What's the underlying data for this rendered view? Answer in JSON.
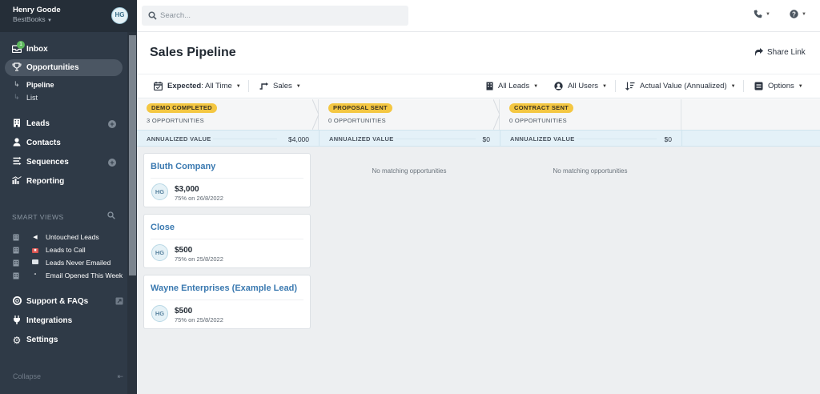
{
  "user": {
    "name": "Henry Goode",
    "org": "BestBooks",
    "initials": "HG"
  },
  "nav": {
    "inbox": "Inbox",
    "inbox_badge": "1",
    "opportunities": "Opportunities",
    "pipeline": "Pipeline",
    "list": "List",
    "leads": "Leads",
    "contacts": "Contacts",
    "sequences": "Sequences",
    "reporting": "Reporting",
    "support": "Support & FAQs",
    "integrations": "Integrations",
    "settings": "Settings",
    "collapse": "Collapse"
  },
  "smart_views": {
    "heading": "SMART VIEWS",
    "items": [
      "Untouched Leads",
      "Leads to Call",
      "Leads Never Emailed",
      "Email Opened This Week"
    ]
  },
  "search": {
    "placeholder": "Search..."
  },
  "header": {
    "title": "Sales Pipeline",
    "share": "Share Link"
  },
  "filters": {
    "expected_key": "Expected",
    "expected_val": ": All Time",
    "pipeline": "Sales",
    "leads": "All Leads",
    "users": "All Users",
    "sort": "Actual Value (Annualized)",
    "options": "Options"
  },
  "value_label": "ANNUALIZED VALUE",
  "stages": [
    {
      "name": "DEMO COMPLETED",
      "count": "3 OPPORTUNITIES",
      "value": "$4,000"
    },
    {
      "name": "PROPOSAL SENT",
      "count": "0 OPPORTUNITIES",
      "value": "$0",
      "empty": "No matching opportunities"
    },
    {
      "name": "CONTRACT SENT",
      "count": "0 OPPORTUNITIES",
      "value": "$0",
      "empty": "No matching opportunities"
    }
  ],
  "cards": [
    {
      "title": "Bluth Company",
      "initials": "HG",
      "amount": "$3,000",
      "meta": "75% on 26/8/2022"
    },
    {
      "title": "Close",
      "initials": "HG",
      "amount": "$500",
      "meta": "75% on 25/8/2022"
    },
    {
      "title": "Wayne Enterprises (Example Lead)",
      "initials": "HG",
      "amount": "$500",
      "meta": "75% on 25/8/2022"
    }
  ],
  "colors": {
    "sidebar": "#2f3a47",
    "stage_badge": "#f4c742",
    "link": "#3a79b0",
    "value_row": "#e4f1f8"
  },
  "icons": [
    "inbox-icon",
    "trophy-icon",
    "building-icon",
    "user-icon",
    "sequences-icon",
    "reporting-icon",
    "support-icon",
    "plug-icon",
    "gear-icon",
    "search-icon",
    "phone-icon",
    "help-icon",
    "share-icon",
    "calendar-icon",
    "funnel-icon",
    "user-circle-icon",
    "sort-icon",
    "options-icon"
  ]
}
